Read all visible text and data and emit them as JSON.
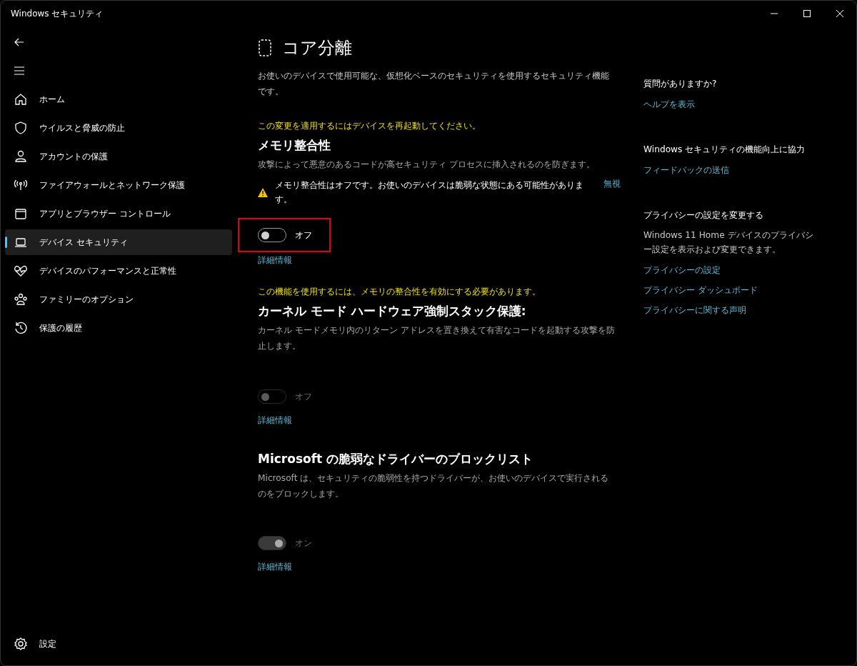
{
  "window": {
    "title": "Windows セキュリティ"
  },
  "sidebar": {
    "items": [
      {
        "label": "ホーム",
        "selected": false
      },
      {
        "label": "ウイルスと脅威の防止",
        "selected": false
      },
      {
        "label": "アカウントの保護",
        "selected": false
      },
      {
        "label": "ファイアウォールとネットワーク保護",
        "selected": false
      },
      {
        "label": "アプリとブラウザー コントロール",
        "selected": false
      },
      {
        "label": "デバイス セキュリティ",
        "selected": true
      },
      {
        "label": "デバイスのパフォーマンスと正常性",
        "selected": false
      },
      {
        "label": "ファミリーのオプション",
        "selected": false
      },
      {
        "label": "保護の履歴",
        "selected": false
      }
    ],
    "settings": "設定"
  },
  "page": {
    "title": "コア分離",
    "description": "お使いのデバイスで使用可能な、仮想化ベースのセキュリティを使用するセキュリティ機能です。",
    "sections": [
      {
        "notice": "この変更を適用するにはデバイスを再起動してください。",
        "heading": "メモリ整合性",
        "description": "攻撃によって悪意のあるコードが高セキュリティ プロセスに挿入されるのを防ぎます。",
        "warning": {
          "text": "メモリ整合性はオフです。お使いのデバイスは脆弱な状態にある可能性があります。",
          "link": "無視"
        },
        "toggle": {
          "on": false,
          "disabled": false,
          "label": "オフ"
        },
        "highlighted": true,
        "link": "詳細情報"
      },
      {
        "notice": "この機能を使用するには、メモリの整合性を有効にする必要があります。",
        "heading": "カーネル モード ハードウェア強制スタック保護:",
        "description": "カーネル モードメモリ内のリターン アドレスを置き換えて有害なコードを起動する攻撃を防止します。",
        "toggle": {
          "on": false,
          "disabled": true,
          "label": "オフ"
        },
        "highlighted": false,
        "link": "詳細情報"
      },
      {
        "heading": "Microsoft の脆弱なドライバーのブロックリスト",
        "description": "Microsoft は、セキュリティの脆弱性を持つドライバーが、お使いのデバイスで実行されるのをブロックします。",
        "toggle": {
          "on": true,
          "disabled": true,
          "label": "オン"
        },
        "highlighted": false,
        "link": "詳細情報"
      }
    ]
  },
  "aside": {
    "groups": [
      {
        "heading": "質問がありますか?",
        "links": [
          "ヘルプを表示"
        ]
      },
      {
        "heading": "Windows セキュリティの機能向上に協力",
        "links": [
          "フィードバックの送信"
        ]
      },
      {
        "heading": "プライバシーの設定を変更する",
        "text": "Windows 11 Home デバイスのプライバシー設定を表示および変更できます。",
        "links": [
          "プライバシーの設定",
          "プライバシー ダッシュボード",
          "プライバシーに関する声明"
        ]
      }
    ]
  }
}
